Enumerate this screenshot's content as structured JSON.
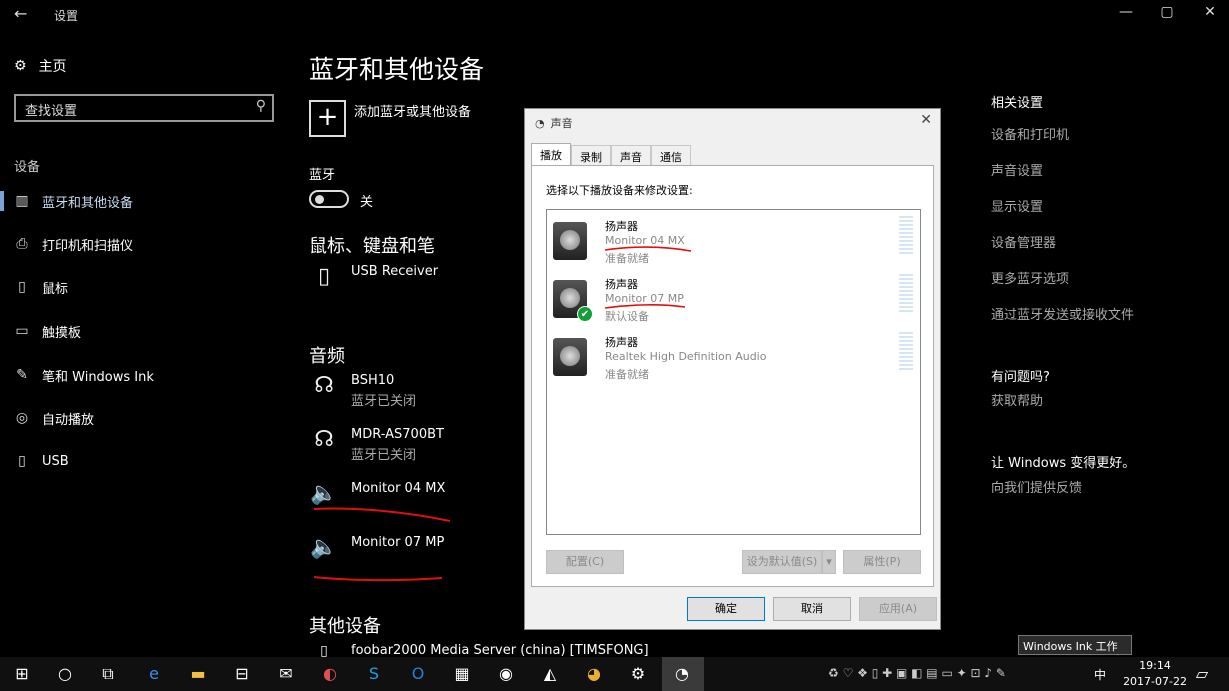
{
  "window": {
    "back": "←",
    "title": "设置",
    "min": "—",
    "max": "▢",
    "close": "✕"
  },
  "sidebar": {
    "home": "主页",
    "search_placeholder": "查找设置",
    "section": "设备",
    "items": [
      {
        "label": "蓝牙和其他设备",
        "icon": "bluetooth-devices-icon"
      },
      {
        "label": "打印机和扫描仪",
        "icon": "printer-icon"
      },
      {
        "label": "鼠标",
        "icon": "mouse-icon"
      },
      {
        "label": "触摸板",
        "icon": "touchpad-icon"
      },
      {
        "label": "笔和 Windows Ink",
        "icon": "pen-icon"
      },
      {
        "label": "自动播放",
        "icon": "autoplay-icon"
      },
      {
        "label": "USB",
        "icon": "usb-icon"
      }
    ]
  },
  "main": {
    "title": "蓝牙和其他设备",
    "add_label": "添加蓝牙或其他设备",
    "bluetooth_heading": "蓝牙",
    "bluetooth_state": "关",
    "mouse_section": "鼠标、键盘和笔",
    "mouse_devices": [
      {
        "name": "USB Receiver"
      }
    ],
    "audio_section": "音频",
    "audio_devices": [
      {
        "name": "BSH10",
        "status": "蓝牙已关闭"
      },
      {
        "name": "MDR-AS700BT",
        "status": "蓝牙已关闭"
      },
      {
        "name": "Monitor 04 MX",
        "status": ""
      },
      {
        "name": "Monitor 07 MP",
        "status": ""
      }
    ],
    "other_section": "其他设备",
    "other_devices": [
      {
        "name": "foobar2000 Media Server (china) [TIMSFONG]"
      }
    ]
  },
  "related": {
    "heading": "相关设置",
    "links": [
      "设备和打印机",
      "声音设置",
      "显示设置",
      "设备管理器",
      "更多蓝牙选项",
      "通过蓝牙发送或接收文件"
    ],
    "help_heading": "有问题吗?",
    "help_link": "获取帮助",
    "feedback_heading": "让 Windows 变得更好。",
    "feedback_link": "向我们提供反馈"
  },
  "dialog": {
    "title": "声音",
    "close": "✕",
    "tabs": [
      "播放",
      "录制",
      "声音",
      "通信"
    ],
    "instruction": "选择以下播放设备来修改设置:",
    "devices": [
      {
        "type": "扬声器",
        "name": "Monitor 04 MX",
        "status": "准备就绪",
        "default": false
      },
      {
        "type": "扬声器",
        "name": "Monitor 07 MP",
        "status": "默认设备",
        "default": true
      },
      {
        "type": "扬声器",
        "name": "Realtek High Definition Audio",
        "status": "准备就绪",
        "default": false
      }
    ],
    "configure": "配置(C)",
    "set_default": "设为默认值(S)",
    "properties": "属性(P)",
    "ok": "确定",
    "cancel": "取消",
    "apply": "应用(A)"
  },
  "taskbar": {
    "tooltip": "Windows Ink 工作区",
    "ime": "中",
    "time": "19:14",
    "date": "2017-07-22"
  },
  "colors": {
    "annotation_red": "#e01010",
    "accent": "#0078d7",
    "default_check": "#12a036"
  }
}
